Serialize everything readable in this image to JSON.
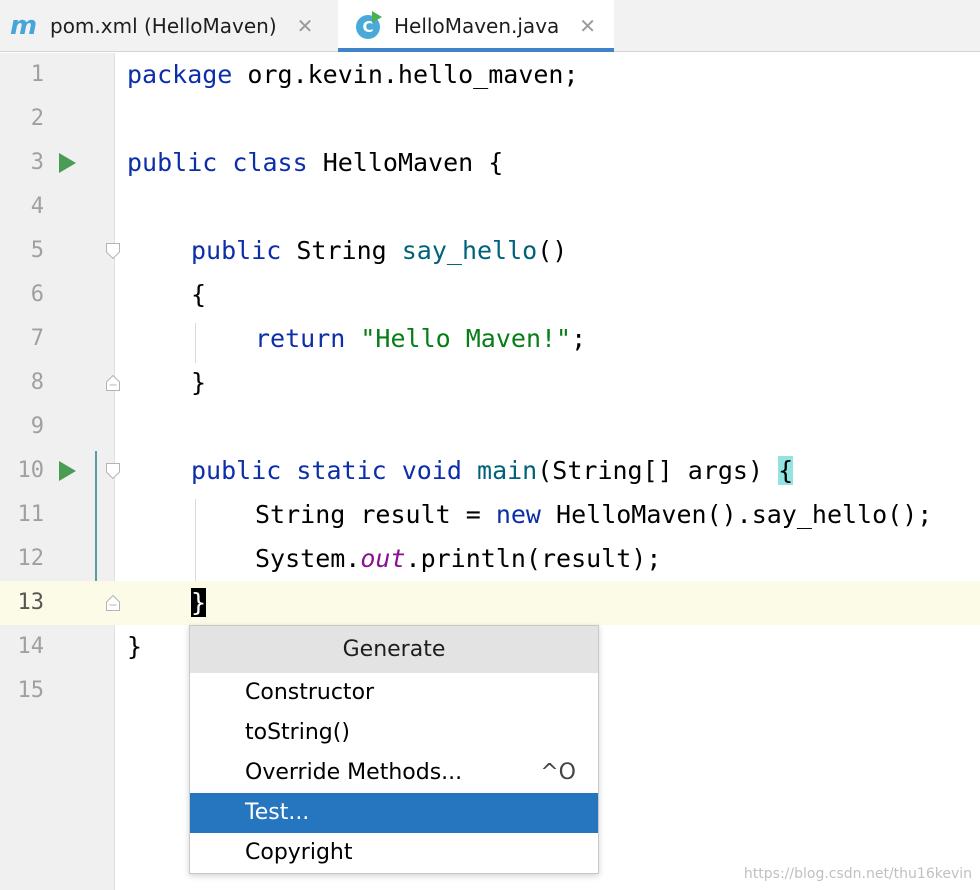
{
  "tabs": [
    {
      "icon": "maven-icon",
      "icon_glyph": "m",
      "label": "pom.xml (HelloMaven)",
      "close": "✕"
    },
    {
      "icon": "java-class-run-icon",
      "icon_glyph": "C",
      "label": "HelloMaven.java",
      "close": "✕",
      "active": true
    }
  ],
  "line_numbers": [
    "1",
    "2",
    "3",
    "4",
    "5",
    "6",
    "7",
    "8",
    "9",
    "10",
    "11",
    "12",
    "13",
    "14",
    "15"
  ],
  "code": {
    "l1_kw": "package",
    "l1_rest": " org.kevin.hello_maven;",
    "l3_kw1": "public",
    "l3_kw2": "class",
    "l3_rest": " HelloMaven {",
    "l5_kw": "public",
    "l5_type": " String ",
    "l5_fn": "say_hello",
    "l5_rest": "()",
    "l6": "{",
    "l7_kw": "return",
    "l7_str": "\"Hello Maven!\"",
    "l7_rest": ";",
    "l8": "}",
    "l10_kw1": "public",
    "l10_kw2": "static",
    "l10_kw3": "void",
    "l10_fn": "main",
    "l10_rest": "(String[] args) ",
    "l10_brace": "{",
    "l11_a": "String result = ",
    "l11_kw": "new",
    "l11_b": " HelloMaven().say_hello();",
    "l12_a": "System.",
    "l12_field": "out",
    "l12_b": ".println(result);",
    "l13": "}",
    "l14": "}"
  },
  "popup": {
    "title": "Generate",
    "items": [
      {
        "label": "Constructor",
        "shortcut": ""
      },
      {
        "label": "toString()",
        "shortcut": ""
      },
      {
        "label": "Override Methods...",
        "shortcut": "^O"
      },
      {
        "label": "Test...",
        "shortcut": "",
        "selected": true
      },
      {
        "label": "Copyright",
        "shortcut": ""
      }
    ]
  },
  "watermark": "https://blog.csdn.net/thu16kevin",
  "colors": {
    "accent": "#2675bf",
    "keyword": "#0c2ea8",
    "string": "#067d17",
    "function": "#00627a",
    "run": "#499c54"
  }
}
